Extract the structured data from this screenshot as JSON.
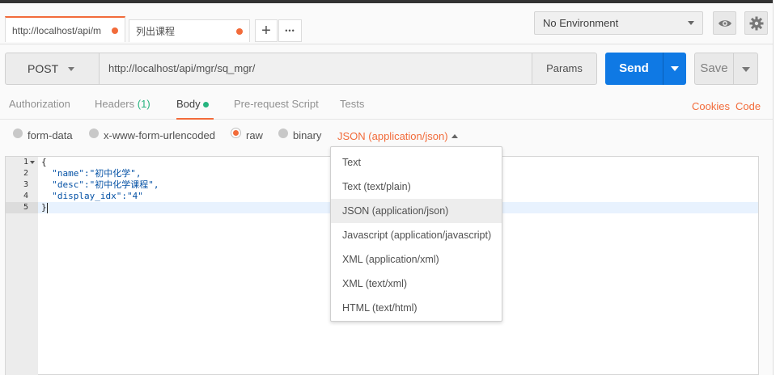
{
  "tabs": [
    {
      "label": "http://localhost/api/m",
      "unsaved": true
    },
    {
      "label": "列出课程",
      "unsaved": true
    }
  ],
  "tab_actions": {
    "add": "+",
    "more": "•••"
  },
  "environment": {
    "selected": "No Environment"
  },
  "icons": {
    "eye": "eye-icon",
    "settings": "gear-icon"
  },
  "request": {
    "method": "POST",
    "url": "http://localhost/api/mgr/sq_mgr/",
    "params_label": "Params",
    "send_label": "Send",
    "save_label": "Save"
  },
  "sub_tabs": [
    {
      "label": "Authorization"
    },
    {
      "label": "Headers",
      "count": "(1)"
    },
    {
      "label": "Body",
      "active": true
    },
    {
      "label": "Pre-request Script"
    },
    {
      "label": "Tests"
    }
  ],
  "links": {
    "cookies": "Cookies",
    "code": "Code"
  },
  "body_types": [
    "form-data",
    "x-www-form-urlencoded",
    "raw",
    "binary"
  ],
  "body_type_selected": "raw",
  "content_type": "JSON (application/json)",
  "editor": {
    "line_numbers": [
      "1",
      "2",
      "3",
      "4",
      "5"
    ],
    "lines": [
      "{",
      "  \"name\":\"初中化学\",",
      "  \"desc\":\"初中化学课程\",",
      "  \"display_idx\":\"4\"",
      "}"
    ]
  },
  "dropdown": {
    "items": [
      "Text",
      "Text (text/plain)",
      "JSON (application/json)",
      "Javascript (application/javascript)",
      "XML (application/xml)",
      "XML (text/xml)",
      "HTML (text/html)"
    ],
    "highlighted": "JSON (application/json)"
  },
  "colors": {
    "accent": "#f26b3a",
    "send": "#0f79e4",
    "active_dot": "#26b47f"
  }
}
